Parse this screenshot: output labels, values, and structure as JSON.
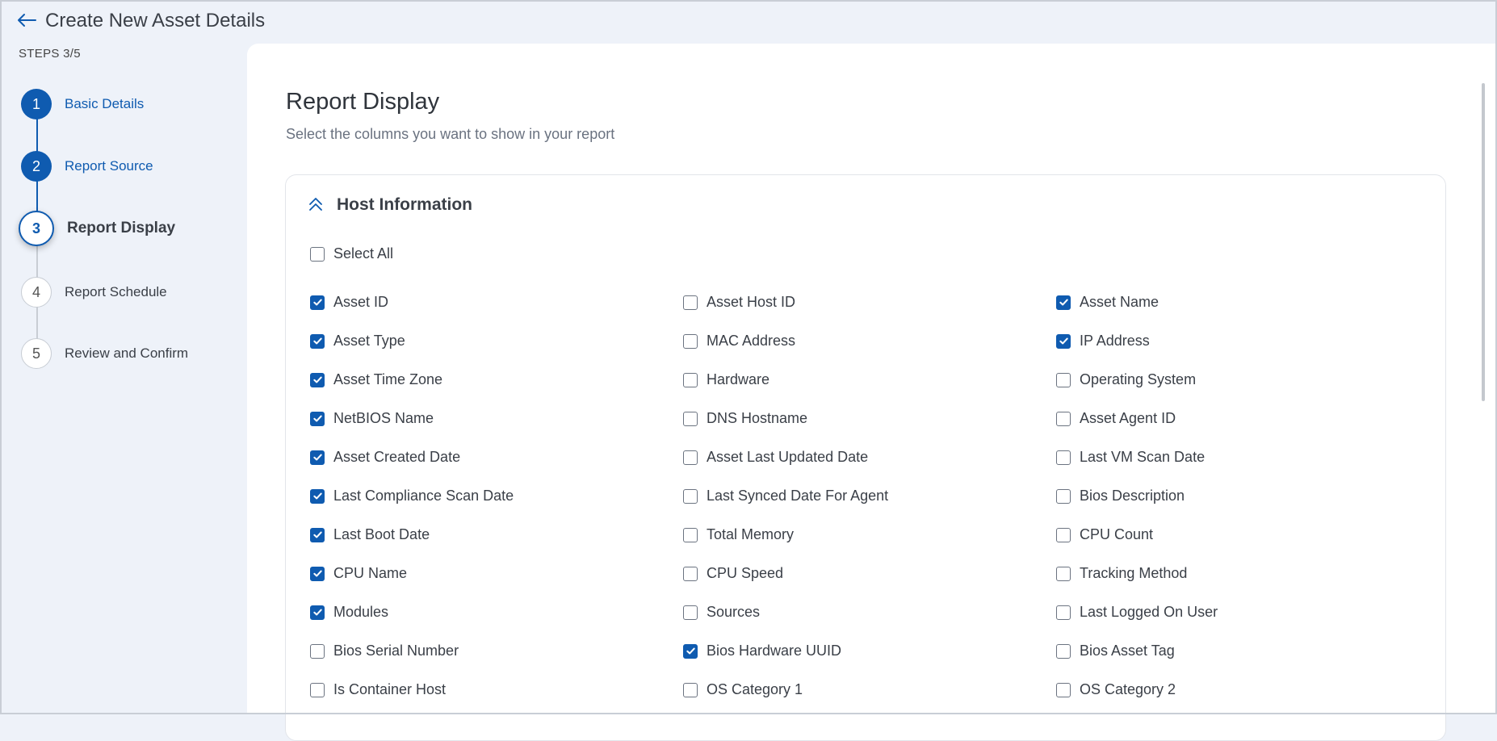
{
  "header": {
    "title": "Create New Asset Details",
    "steps_label": "STEPS 3/5"
  },
  "steps": [
    {
      "num": "1",
      "label": "Basic Details",
      "state": "done"
    },
    {
      "num": "2",
      "label": "Report Source",
      "state": "done"
    },
    {
      "num": "3",
      "label": "Report Display",
      "state": "current"
    },
    {
      "num": "4",
      "label": "Report Schedule",
      "state": "todo"
    },
    {
      "num": "5",
      "label": "Review and Confirm",
      "state": "todo"
    }
  ],
  "main": {
    "title": "Report Display",
    "subtitle": "Select the columns you want to show in your report",
    "section_title": "Host Information",
    "select_all": {
      "label": "Select All",
      "checked": false
    },
    "columns": [
      [
        {
          "label": "Asset ID",
          "checked": true
        },
        {
          "label": "Asset Type",
          "checked": true
        },
        {
          "label": "Asset Time Zone",
          "checked": true
        },
        {
          "label": "NetBIOS Name",
          "checked": true
        },
        {
          "label": "Asset Created Date",
          "checked": true
        },
        {
          "label": "Last Compliance Scan Date",
          "checked": true
        },
        {
          "label": "Last Boot Date",
          "checked": true
        },
        {
          "label": "CPU Name",
          "checked": true
        },
        {
          "label": "Modules",
          "checked": true
        },
        {
          "label": "Bios Serial Number",
          "checked": false
        },
        {
          "label": "Is Container Host",
          "checked": false
        }
      ],
      [
        {
          "label": "Asset Host ID",
          "checked": false
        },
        {
          "label": "MAC Address",
          "checked": false
        },
        {
          "label": "Hardware",
          "checked": false
        },
        {
          "label": "DNS Hostname",
          "checked": false
        },
        {
          "label": "Asset Last Updated Date",
          "checked": false
        },
        {
          "label": "Last Synced Date For Agent",
          "checked": false
        },
        {
          "label": "Total Memory",
          "checked": false
        },
        {
          "label": "CPU Speed",
          "checked": false
        },
        {
          "label": "Sources",
          "checked": false
        },
        {
          "label": "Bios Hardware UUID",
          "checked": true
        },
        {
          "label": "OS Category 1",
          "checked": false
        }
      ],
      [
        {
          "label": "Asset Name",
          "checked": true
        },
        {
          "label": "IP Address",
          "checked": true
        },
        {
          "label": "Operating System",
          "checked": false
        },
        {
          "label": "Asset Agent ID",
          "checked": false
        },
        {
          "label": "Last VM Scan Date",
          "checked": false
        },
        {
          "label": "Bios Description",
          "checked": false
        },
        {
          "label": "CPU Count",
          "checked": false
        },
        {
          "label": "Tracking Method",
          "checked": false
        },
        {
          "label": "Last Logged On User",
          "checked": false
        },
        {
          "label": "Bios Asset Tag",
          "checked": false
        },
        {
          "label": "OS Category 2",
          "checked": false
        }
      ]
    ]
  },
  "colors": {
    "accent": "#0f5bb0",
    "sidebar_bg": "#eef2f9"
  }
}
